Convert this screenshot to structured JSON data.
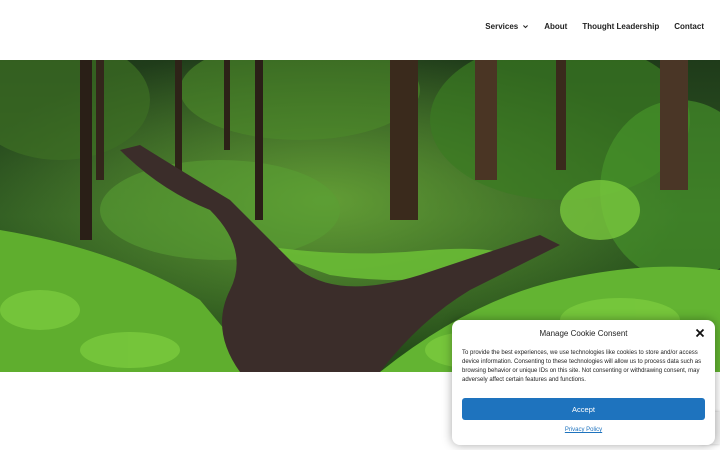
{
  "nav": {
    "items": [
      {
        "label": "Services",
        "has_dropdown": true
      },
      {
        "label": "About"
      },
      {
        "label": "Thought Leadership"
      },
      {
        "label": "Contact"
      }
    ]
  },
  "hero": {
    "image": "forest-path-fork"
  },
  "cookie": {
    "title": "Manage Cookie Consent",
    "text": "To provide the best experiences, we use technologies like cookies to store and/or access device information. Consenting to these technologies will allow us to process data such as browsing behavior or unique IDs on this site. Not consenting or withdrawing consent, may adversely affect certain features and functions.",
    "accept_label": "Accept",
    "policy_label": "Privacy Policy",
    "accent_color": "#1e73be"
  }
}
